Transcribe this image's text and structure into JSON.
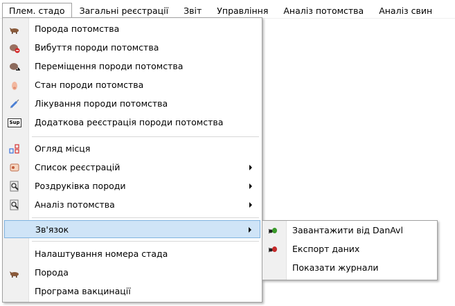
{
  "menubar": {
    "items": [
      "Плем. стадо",
      "Загальні реєстрації",
      "Звіт",
      "Управління",
      "Аналіз потомства",
      "Аналіз свин"
    ]
  },
  "main_menu": {
    "items": [
      {
        "label": "Порода потомства",
        "icon": "pig-icon"
      },
      {
        "label": "Вибуття породи потомства",
        "icon": "pig-remove-icon"
      },
      {
        "label": "Переміщення породи потомства",
        "icon": "pig-move-icon"
      },
      {
        "label": "Стан породи потомства",
        "icon": "piglet-icon"
      },
      {
        "label": "Лікування породи потомства",
        "icon": "syringe-icon"
      },
      {
        "label": "Додаткова реєстрація породи потомства",
        "icon": "sup-icon",
        "icon_text": "Sup"
      },
      {
        "label": "Огляд місця",
        "icon": "location-overview-icon"
      },
      {
        "label": "Список реєстрацій",
        "icon": "registration-list-icon"
      },
      {
        "label": "Роздруківка породи",
        "icon": "print-preview-icon"
      },
      {
        "label": "Аналіз потомства",
        "icon": "analysis-icon"
      },
      {
        "label": "Зв'язок",
        "icon": ""
      },
      {
        "label": "Налаштування номера стада",
        "icon": ""
      },
      {
        "label": "Порода",
        "icon": "pig-icon"
      },
      {
        "label": "Програма вакцинації",
        "icon": ""
      }
    ]
  },
  "sub_menu": {
    "items": [
      {
        "label": "Завантажити від DanAvl",
        "icon": "ant-download-icon"
      },
      {
        "label": "Експорт даних",
        "icon": "ant-export-icon"
      },
      {
        "label": "Показати журнали",
        "icon": ""
      }
    ]
  },
  "colors": {
    "highlight": "#cfe4f7",
    "highlight_border": "#7fb3e0",
    "gutter": "#f0f0f0"
  }
}
